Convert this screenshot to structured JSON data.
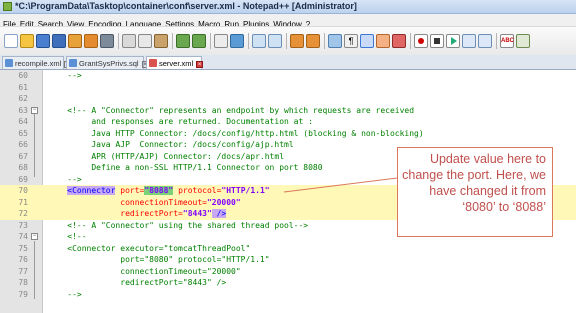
{
  "window": {
    "title": "*C:\\ProgramData\\Tasktop\\container\\conf\\server.xml - Notepad++ [Administrator]"
  },
  "menu": [
    "File",
    "Edit",
    "Search",
    "View",
    "Encoding",
    "Language",
    "Settings",
    "Macro",
    "Run",
    "Plugins",
    "Window",
    "?"
  ],
  "toolbar_icons": [
    "new-file-icon",
    "open-file-icon",
    "save-icon",
    "save-all-icon",
    "close-icon",
    "close-all-icon",
    "print-icon",
    "cut-icon",
    "copy-icon",
    "paste-icon",
    "undo-icon",
    "redo-icon",
    "find-icon",
    "replace-icon",
    "zoom-in-icon",
    "zoom-out-icon",
    "sync-vertical-icon",
    "sync-horizontal-icon",
    "word-wrap-icon",
    "all-chars-icon",
    "indent-guide-icon",
    "user-lang-icon",
    "doc-map-icon",
    "record-macro-icon",
    "stop-record-icon",
    "play-macro-icon",
    "play-multiple-icon",
    "save-macro-icon",
    "spell-check-icon",
    "abc-options-icon"
  ],
  "tabs": [
    {
      "label": "recompile.xml",
      "active": false
    },
    {
      "label": "GrantSysPrivs.sql",
      "active": false
    },
    {
      "label": "server.xml",
      "active": true
    }
  ],
  "editor": {
    "lines": [
      {
        "num": "60",
        "text": "    -->"
      },
      {
        "num": "61",
        "text": ""
      },
      {
        "num": "62",
        "text": ""
      },
      {
        "num": "63",
        "text": "    <!-- A \"Connector\" represents an endpoint by which requests are received"
      },
      {
        "num": "64",
        "text": "         and responses are returned. Documentation at :"
      },
      {
        "num": "65",
        "text": "         Java HTTP Connector: /docs/config/http.html (blocking & non-blocking)"
      },
      {
        "num": "66",
        "text": "         Java AJP  Connector: /docs/config/ajp.html"
      },
      {
        "num": "67",
        "text": "         APR (HTTP/AJP) Connector: /docs/apr.html"
      },
      {
        "num": "68",
        "text": "         Define a non-SSL HTTP/1.1 Connector on port 8080"
      },
      {
        "num": "69",
        "text": "    -->"
      },
      {
        "num": "70",
        "text": "    <Connector port=\"8088\" protocol=\"HTTP/1.1\""
      },
      {
        "num": "71",
        "text": "               connectionTimeout=\"20000\""
      },
      {
        "num": "72",
        "text": "               redirectPort=\"8443\" />"
      },
      {
        "num": "73",
        "text": "    <!-- A \"Connector\" using the shared thread pool-->"
      },
      {
        "num": "74",
        "text": "    <!--"
      },
      {
        "num": "75",
        "text": "    <Connector executor=\"tomcatThreadPool\""
      },
      {
        "num": "76",
        "text": "               port=\"8080\" protocol=\"HTTP/1.1\""
      },
      {
        "num": "77",
        "text": "               connectionTimeout=\"20000\""
      },
      {
        "num": "78",
        "text": "               redirectPort=\"8443\" />"
      },
      {
        "num": "79",
        "text": "    -->"
      }
    ],
    "seg70": {
      "indent": "    ",
      "tag": "<Connector",
      "attr1": " port=",
      "val1": "\"8088\"",
      "attr2": " protocol=",
      "val2": "\"HTTP/1.1\""
    },
    "seg71": {
      "indent": "               ",
      "attr": "connectionTimeout=",
      "val": "\"20000\""
    },
    "seg72": {
      "indent": "               ",
      "attr": "redirectPort=",
      "val": "\"8443\"",
      "close": " />"
    }
  },
  "callout": {
    "text": "Update value here to change the port.  Here, we have changed it from ‘8080’ to ‘8088’"
  },
  "colors": {
    "callout_text": "#c0504d",
    "callout_border": "#d9785a",
    "comment": "#008000",
    "tag": "#0000ff",
    "attribute": "#ff0000",
    "value": "#8000ff",
    "highlight_row": "#fff8b6"
  }
}
